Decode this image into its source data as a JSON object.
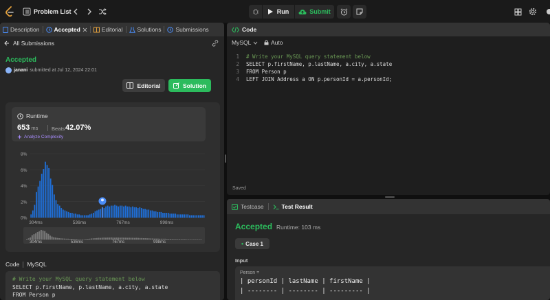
{
  "topbar": {
    "problem_list": "Problem List",
    "run": "Run",
    "submit": "Submit"
  },
  "left_tabs": [
    {
      "label": "Description"
    },
    {
      "label": "Accepted"
    },
    {
      "label": "Editorial"
    },
    {
      "label": "Solutions"
    },
    {
      "label": "Submissions"
    }
  ],
  "submission": {
    "back_label": "All Submissions",
    "status": "Accepted",
    "user": "janani",
    "submitted_text": "submitted at Jul 12, 2024 22:01",
    "editorial_button": "Editorial",
    "solution_button": "Solution"
  },
  "runtime": {
    "label": "Runtime",
    "value": "653",
    "unit": "ms",
    "beats_label": "Beats",
    "beats_value": "42.07%",
    "analyze": "Analyze Complexity"
  },
  "chart_data": {
    "type": "bar",
    "yticks": [
      "8%",
      "6%",
      "4%",
      "2%",
      "0%"
    ],
    "ylim": [
      0,
      8
    ],
    "xticks": [
      "304ms",
      "536ms",
      "767ms",
      "998ms"
    ],
    "mini_xticks": [
      "304ms",
      "536ms",
      "767ms",
      "998ms"
    ],
    "marker_index": 40,
    "values": [
      0.4,
      0.9,
      1.6,
      3.2,
      3.9,
      4.6,
      5.5,
      6.1,
      7.0,
      6.6,
      6.2,
      4.9,
      4.1,
      2.9,
      2.2,
      1.7,
      1.5,
      1.2,
      1.0,
      0.9,
      0.8,
      0.7,
      0.6,
      0.6,
      0.5,
      0.5,
      0.4,
      0.4,
      0.3,
      0.3,
      0.3,
      0.3,
      0.3,
      0.4,
      0.5,
      0.6,
      0.8,
      0.9,
      1.0,
      1.1,
      1.3,
      1.2,
      1.4,
      1.5,
      1.4,
      1.5,
      1.5,
      1.6,
      1.5,
      1.4,
      1.5,
      1.5,
      1.4,
      1.5,
      1.4,
      1.4,
      1.3,
      1.4,
      1.3,
      1.3,
      1.2,
      1.3,
      1.2,
      1.1,
      1.1,
      1.0,
      1.0,
      0.9,
      0.9,
      0.8,
      0.8,
      0.7,
      0.7,
      0.7,
      0.6,
      0.6,
      0.6,
      0.6,
      0.5,
      0.5,
      0.5,
      0.5,
      0.4,
      0.4,
      0.4,
      0.4,
      0.4,
      0.4,
      0.4,
      0.3,
      0.3,
      0.3,
      0.3,
      0.3,
      0.3,
      0.3,
      0.3,
      0.3
    ]
  },
  "code_section": {
    "label": "Code",
    "lang": "MySQL"
  },
  "editor": {
    "title": "Code",
    "language": "MySQL",
    "auto": "Auto",
    "saved": "Saved",
    "lines": [
      "# Write your MySQL query statement below",
      "SELECT p.firstName, p.lastName, a.city, a.state",
      "FROM Person p",
      "LEFT JOIN Address a ON p.personId = a.personId;"
    ]
  },
  "test": {
    "testcase_tab": "Testcase",
    "result_tab": "Test Result",
    "status": "Accepted",
    "runtime": "Runtime: 103 ms",
    "case": "Case 1",
    "input_label": "Input",
    "person_label": "Person =",
    "table_header": "| personId | lastName | firstName |",
    "table_rule": "| -------- | -------- | --------- |"
  }
}
